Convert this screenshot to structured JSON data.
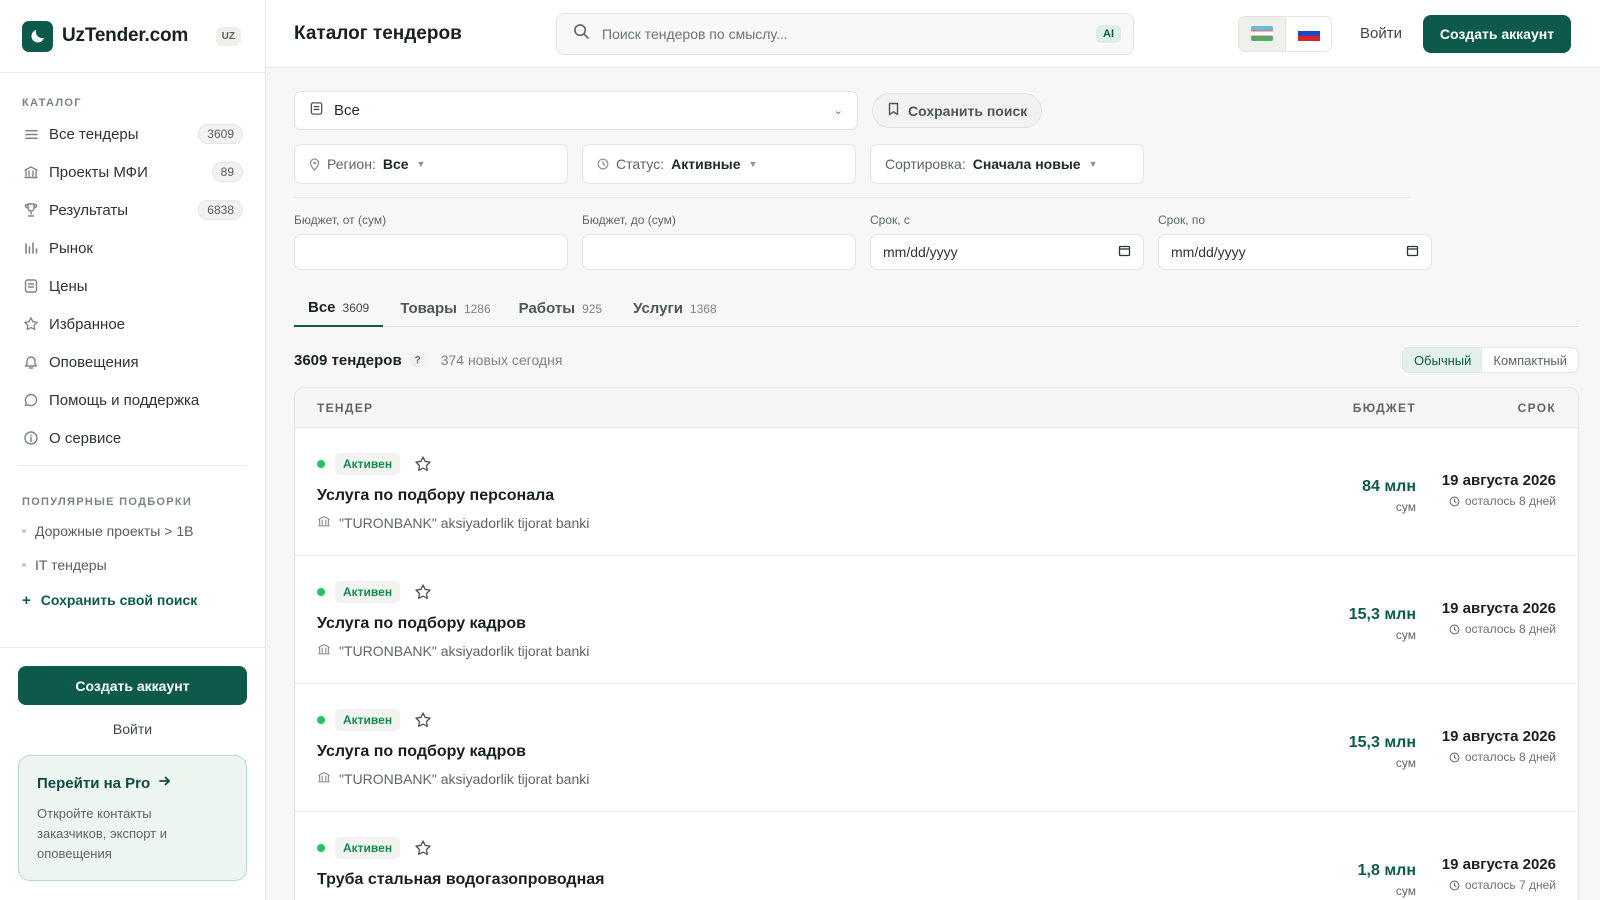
{
  "brand": {
    "name": "UzTender.com",
    "lang": "UZ"
  },
  "sidebar": {
    "catalog_caption": "КАТАЛОГ",
    "items": [
      {
        "label": "Все тендеры",
        "count": "3609",
        "icon": "list-icon"
      },
      {
        "label": "Проекты МФИ",
        "count": "89",
        "icon": "bank-icon"
      },
      {
        "label": "Результаты",
        "count": "6838",
        "icon": "trophy-icon"
      },
      {
        "label": "Рынок",
        "count": "",
        "icon": "bar-chart-icon"
      },
      {
        "label": "Цены",
        "count": "",
        "icon": "price-list-icon"
      },
      {
        "label": "Избранное",
        "count": "",
        "icon": "star-icon"
      },
      {
        "label": "Оповещения",
        "count": "",
        "icon": "bell-icon"
      },
      {
        "label": "Помощь и поддержка",
        "count": "",
        "icon": "chat-icon"
      },
      {
        "label": "О сервисе",
        "count": "",
        "icon": "info-icon"
      }
    ],
    "collections_caption": "ПОПУЛЯРНЫЕ ПОДБОРКИ",
    "collections": [
      "Дорожные проекты > 1B",
      "IT тендеры"
    ],
    "save_own": "Сохранить свой поиск",
    "create_account": "Создать аккаунт",
    "login": "Войти",
    "pro": {
      "title": "Перейти на Pro",
      "text": "Откройте контакты заказчиков, экспорт и оповещения"
    }
  },
  "header": {
    "title": "Каталог тендеров",
    "search_placeholder": "Поиск тендеров по смыслу...",
    "ai_badge": "AI",
    "login": "Войти",
    "create_account": "Создать аккаунт"
  },
  "filters": {
    "type_value": "Все",
    "save_search": "Сохранить поиск",
    "region_label": "Регион:",
    "region_value": "Все",
    "status_label": "Статус:",
    "status_value": "Активные",
    "sort_label": "Сортировка:",
    "sort_value": "Сначала новые",
    "budget_from_label": "Бюджет, от (сум)",
    "budget_to_label": "Бюджет, до (сум)",
    "date_from_label": "Срок, с",
    "date_to_label": "Срок, по",
    "date_placeholder": "mm/dd/yyyy"
  },
  "tabs": [
    {
      "label": "Все",
      "count": "3609",
      "active": true
    },
    {
      "label": "Товары",
      "count": "1286"
    },
    {
      "label": "Работы",
      "count": "925"
    },
    {
      "label": "Услуги",
      "count": "1368"
    }
  ],
  "summary": {
    "total": "3609 тендеров",
    "help": "?",
    "today": "374 новых сегодня",
    "view_normal": "Обычный",
    "view_compact": "Компактный"
  },
  "table": {
    "col_tender": "ТЕНДЕР",
    "col_budget": "БЮДЖЕТ",
    "col_deadline": "СРОК",
    "rows": [
      {
        "status": "Активен",
        "title": "Услуга по подбору персонала",
        "org": "\"TURONBANK\" aksiyadorlik tijorat banki",
        "amount": "84 млн",
        "currency": "сум",
        "date": "19 августа 2026",
        "left": "осталось 8 дней"
      },
      {
        "status": "Активен",
        "title": "Услуга по подбору кадров",
        "org": "\"TURONBANK\" aksiyadorlik tijorat banki",
        "amount": "15,3 млн",
        "currency": "сум",
        "date": "19 августа 2026",
        "left": "осталось 8 дней"
      },
      {
        "status": "Активен",
        "title": "Услуга по подбору кадров",
        "org": "\"TURONBANK\" aksiyadorlik tijorat banki",
        "amount": "15,3 млн",
        "currency": "сум",
        "date": "19 августа 2026",
        "left": "осталось 8 дней"
      },
      {
        "status": "Активен",
        "title": "Труба стальная водогазопроводная",
        "org": "",
        "amount": "1,8 млн",
        "currency": "сум",
        "date": "19 августа 2026",
        "left": "осталось 7 дней"
      }
    ]
  },
  "colors": {
    "accent": "#0d5a4c",
    "active_status": "#22c55e"
  }
}
